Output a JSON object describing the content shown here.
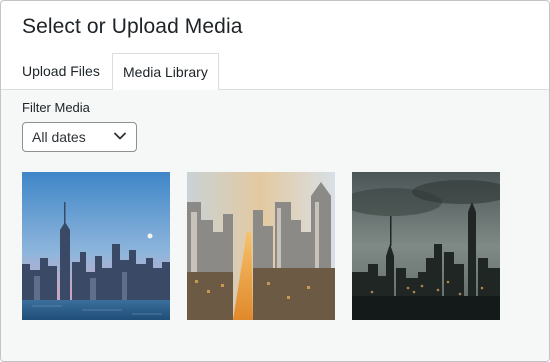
{
  "modal": {
    "title": "Select or Upload Media"
  },
  "tabs": [
    {
      "label": "Upload Files",
      "active": false
    },
    {
      "label": "Media Library",
      "active": true
    }
  ],
  "filter": {
    "label": "Filter Media",
    "selected": "All dates",
    "icon": "chevron-down-icon"
  },
  "attachments": [
    {
      "kind": "image",
      "subject": "waterfront skyline at dusk",
      "accent": "#5b9bd5"
    },
    {
      "kind": "image",
      "subject": "aerial city avenue at sunset",
      "accent": "#d89a4a"
    },
    {
      "kind": "image",
      "subject": "skyline under cloudy sky",
      "accent": "#3d4a4e"
    }
  ]
}
